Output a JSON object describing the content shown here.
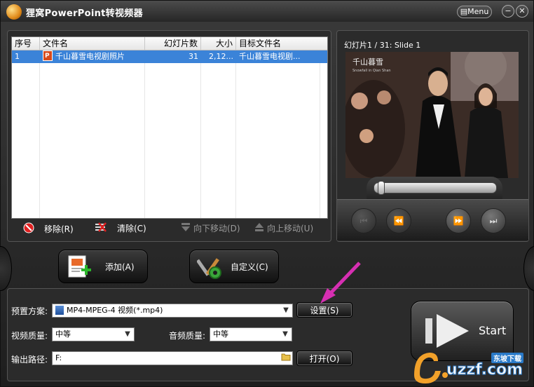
{
  "window": {
    "title": "狸窝PowerPoint转视频器",
    "menu_label": "Menu",
    "min_label": "−",
    "close_label": "✕"
  },
  "file_list": {
    "columns": [
      "序号",
      "文件名",
      "幻灯片数",
      "大小",
      "目标文件名"
    ],
    "rows": [
      {
        "index": "1",
        "file_name": "千山暮雪电视剧照片",
        "slide_count": "31",
        "size": "2,12...",
        "target": "千山暮雪电视剧..."
      }
    ]
  },
  "list_actions": {
    "remove": "移除(R)",
    "clear": "清除(C)",
    "move_down": "向下移动(D)",
    "move_up": "向上移动(U)"
  },
  "preview": {
    "slide_title": "幻灯片1 / 31: Slide 1",
    "photo_caption": "千山暮雪",
    "photo_sub": "Snowfall in Qian Shan"
  },
  "buttons": {
    "add": "添加(A)",
    "customize": "自定义(C)",
    "settings": "设置(S)",
    "open": "打开(O)",
    "start": "Start"
  },
  "options": {
    "preset_label": "预置方案:",
    "preset_value": "MP4-MPEG-4 视频(*.mp4)",
    "video_quality_label": "视频质量:",
    "video_quality_value": "中等",
    "audio_quality_label": "音频质量:",
    "audio_quality_value": "中等",
    "output_label": "输出路径:",
    "output_value": "F:"
  },
  "watermark": {
    "brand": "uzzf.com",
    "tag": "东坡下载"
  },
  "colors": {
    "selection": "#3b83d8",
    "arrow": "#d62fb2",
    "accent_orange": "#f2a12a"
  }
}
